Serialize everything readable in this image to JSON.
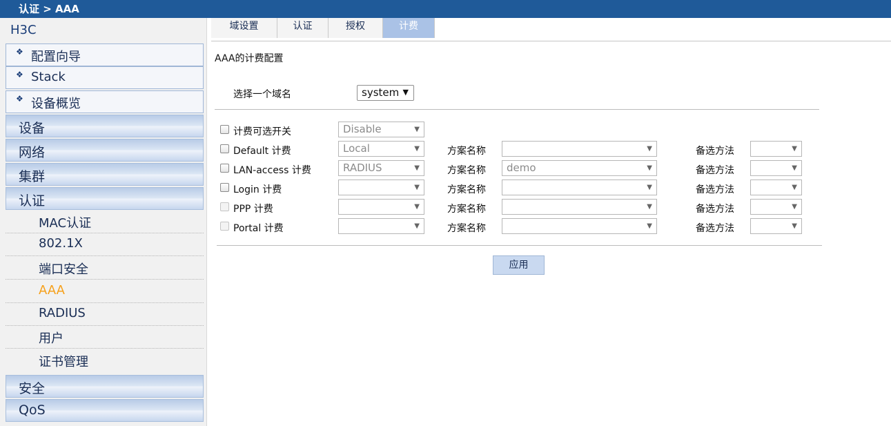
{
  "topbar": {
    "breadcrumb": "认证 > AAA"
  },
  "sidebar": {
    "brand": "H3C",
    "wizard_items": [
      {
        "label": "配置向导",
        "icon": "diamond-bullet-icon"
      },
      {
        "label": "Stack",
        "icon": "diamond-bullet-icon"
      },
      {
        "label": "设备概览",
        "icon": "diamond-bullet-icon"
      }
    ],
    "categories": [
      "设备",
      "网络",
      "集群",
      "认证"
    ],
    "auth_sub_items": [
      "MAC认证",
      "802.1X",
      "端口安全",
      "AAA",
      "RADIUS",
      "用户",
      "证书管理"
    ],
    "active_sub_item": "AAA",
    "bottom_categories": [
      "安全",
      "QoS"
    ]
  },
  "tabs": [
    {
      "label": "域设置",
      "active": false
    },
    {
      "label": "认证",
      "active": false
    },
    {
      "label": "授权",
      "active": false
    },
    {
      "label": "计费",
      "active": true
    }
  ],
  "content": {
    "section_title": "AAA的计费配置",
    "domain_label": "选择一个域名",
    "domain_value": "system",
    "scheme_label": "方案名称",
    "backup_label": "备选方法",
    "apply_label": "应用",
    "rows": [
      {
        "label": "计费可选开关",
        "method": "Disable",
        "scheme": null,
        "disabled": false
      },
      {
        "label": "Default 计费",
        "method": "Local",
        "scheme": "",
        "disabled": false
      },
      {
        "label": "LAN-access 计费",
        "method": "RADIUS",
        "scheme": "demo",
        "disabled": false
      },
      {
        "label": "Login 计费",
        "method": "",
        "scheme": "",
        "disabled": false
      },
      {
        "label": "PPP 计费",
        "method": "",
        "scheme": "",
        "disabled": true
      },
      {
        "label": "Portal 计费",
        "method": "",
        "scheme": "",
        "disabled": true
      }
    ]
  },
  "colors": {
    "topbar": "#1f5a99",
    "active_tab": "#aac2e6",
    "active_sub_item": "#f6a01a"
  }
}
